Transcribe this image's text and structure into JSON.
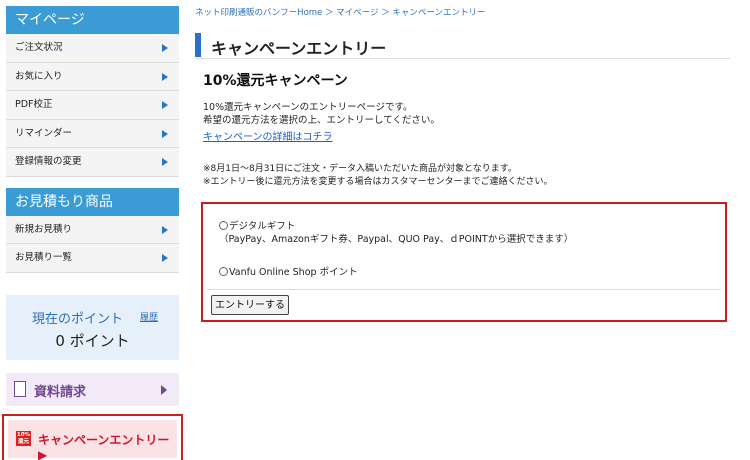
{
  "sidebar": {
    "mypage": {
      "title": "マイページ",
      "items": [
        {
          "label": "ご注文状況"
        },
        {
          "label": "お気に入り"
        },
        {
          "label": "PDF校正"
        },
        {
          "label": "リマインダー"
        },
        {
          "label": "登録情報の変更"
        }
      ]
    },
    "quote": {
      "title": "お見積もり商品",
      "items": [
        {
          "label": "新規お見積り"
        },
        {
          "label": "お見積り一覧"
        }
      ]
    },
    "points": {
      "title": "現在のポイント",
      "history_link": "履歴",
      "value": "0 ポイント"
    },
    "doc_request": {
      "label": "資料請求",
      "icon": "document-icon"
    },
    "campaign": {
      "label": "キャンペーンエントリー▶",
      "badge": "10%\n還元",
      "highlight_color": "#cc1f1f"
    }
  },
  "breadcrumb": "ネット印刷通販のバンフーHome ＞ マイページ ＞ キャンペーンエントリー",
  "page_title": "キャンペーンエントリー",
  "campaign": {
    "title": "10%還元キャンペーン",
    "intro_line1": "10%還元キャンペーンのエントリーページです。",
    "intro_line2": "希望の還元方法を選択の上、エントリーしてください。",
    "detail_link": "キャンペーンの詳細はコチラ",
    "note1": "※8月1日～8月31日にご注文・データ入稿いただいた商品が対象となります。",
    "note2": "※エントリー後に還元方法を変更する場合はカスタマーセンターまでご連絡ください。"
  },
  "entry_form": {
    "option1_label": "デジタルギフト",
    "option1_detail": "（PayPay、Amazonギフト券、Paypal、QUO Pay、ｄPOINTから選択できます）",
    "option2_label": "Vanfu Online Shop ポイント",
    "submit_label": "エントリーする",
    "highlight_color": "#c91d1d"
  },
  "colors": {
    "accent_blue": "#3a9bd5",
    "link_blue": "#1a5fd0",
    "campaign_red": "#d1142e",
    "doc_purple": "#6e4a8e"
  }
}
